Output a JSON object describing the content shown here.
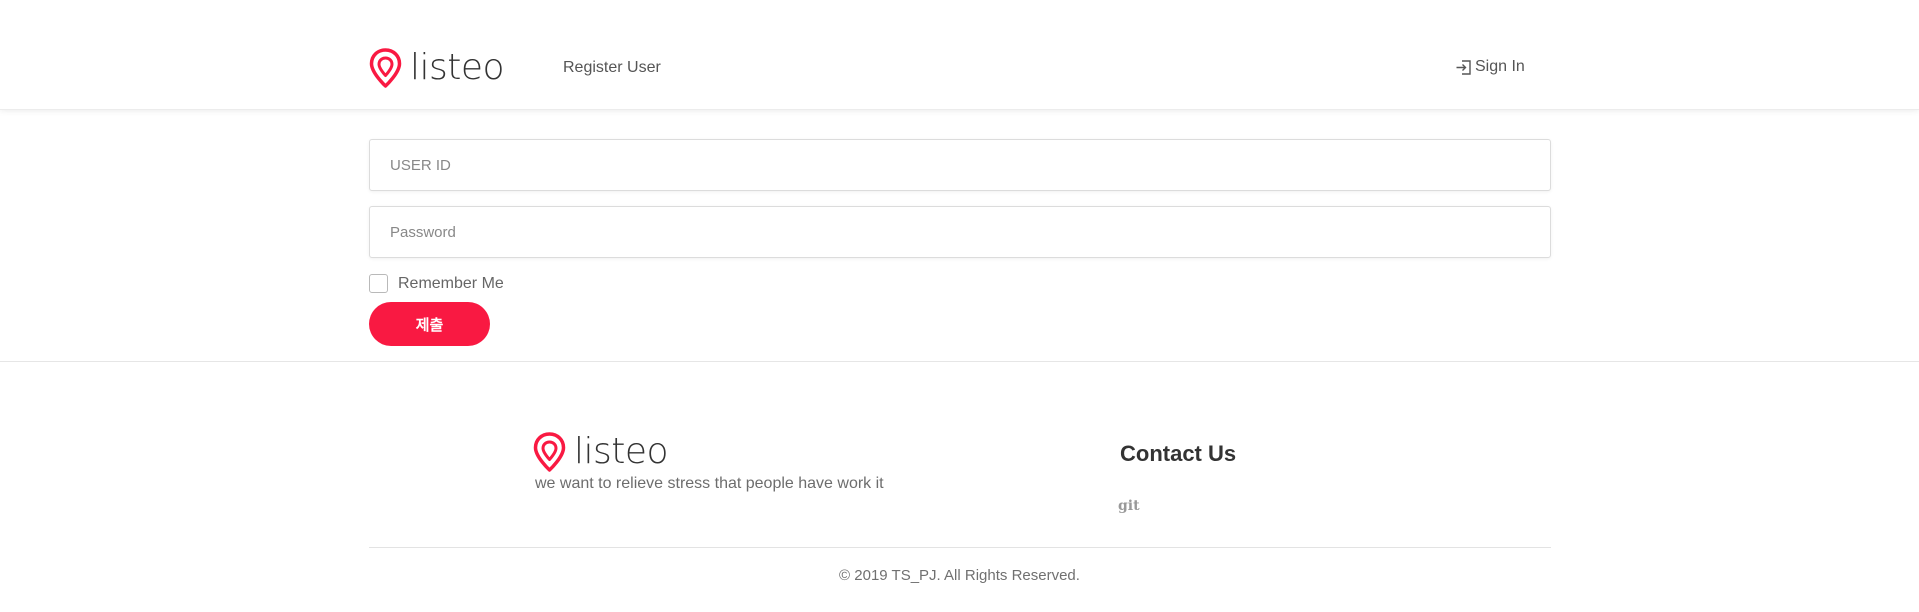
{
  "header": {
    "logo_text": "listeo",
    "nav_register": "Register User",
    "signin_label": "Sign In"
  },
  "form": {
    "userid_placeholder": "USER ID",
    "password_placeholder": "Password",
    "remember_label": "Remember Me",
    "submit_label": "제출"
  },
  "footer": {
    "logo_text": "listeo",
    "tagline": "we want to relieve stress that people have work it",
    "contact_title": "Contact Us",
    "git_label": "git",
    "copyright": "© 2019 TS_PJ. All Rights Reserved."
  },
  "colors": {
    "accent": "#f91942"
  },
  "icons": {
    "logo": "map-pin-icon",
    "signin": "sign-in-icon"
  }
}
